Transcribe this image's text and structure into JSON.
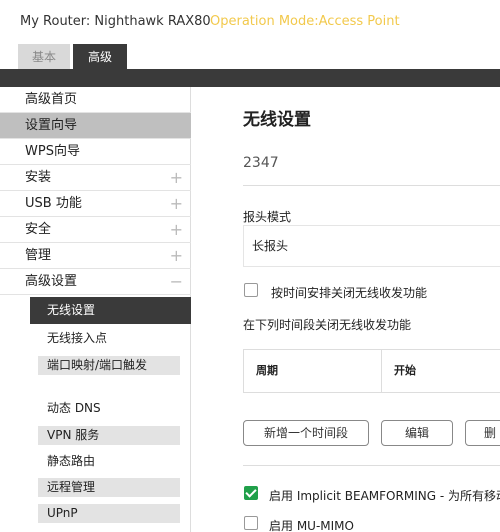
{
  "header": {
    "router_name": "My Router: Nighthawk RAX80",
    "operation_mode": "Operation Mode:Access Point"
  },
  "tabs": [
    {
      "label": "基本"
    },
    {
      "label": "高级"
    }
  ],
  "sidebar": {
    "items": [
      {
        "label": "高级首页",
        "sign": ""
      },
      {
        "label": "设置向导",
        "sign": ""
      },
      {
        "label": "WPS向导",
        "sign": ""
      },
      {
        "label": "安装",
        "sign": "+"
      },
      {
        "label": "USB 功能",
        "sign": "+"
      },
      {
        "label": "安全",
        "sign": "+"
      },
      {
        "label": "管理",
        "sign": "+"
      },
      {
        "label": "高级设置",
        "sign": "−"
      }
    ],
    "sub_items": [
      {
        "label": "无线设置"
      },
      {
        "label": "无线接入点"
      },
      {
        "label": "端口映射/端口触发"
      },
      {
        "label": "动态 DNS"
      },
      {
        "label": "VPN 服务"
      },
      {
        "label": "静态路由"
      },
      {
        "label": "远程管理"
      },
      {
        "label": "UPnP"
      }
    ]
  },
  "main": {
    "title": "无线设置",
    "region": "2347",
    "preamble_label": "报头模式",
    "preamble_value": "长报头",
    "schedule_checkbox_label": "按时间安排关闭无线收发功能",
    "schedule_section_label": "在下列时间段关闭无线收发功能",
    "table_headers": [
      "周期",
      "开始"
    ],
    "buttons": {
      "add": "新增一个时间段",
      "edit": "编辑",
      "delete": "删"
    },
    "beamforming_label": "启用 Implicit BEAMFORMING - 为所有移动",
    "beamforming_checked": true,
    "mumimo_label": "启用 MU-MIMO",
    "mumimo_checked": false
  }
}
